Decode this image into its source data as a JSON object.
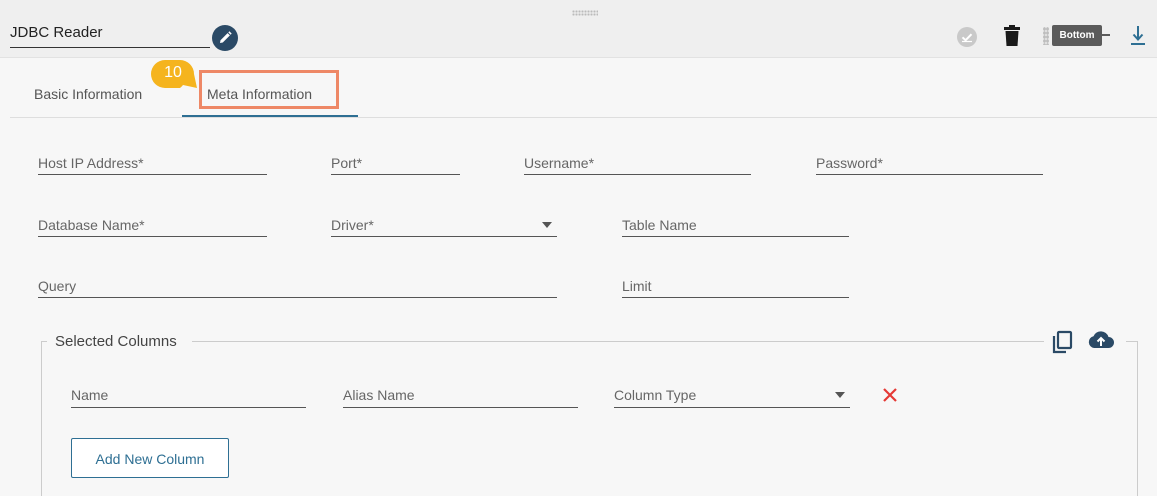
{
  "header": {
    "title": "JDBC Reader",
    "tooltip": "Bottom",
    "icons": [
      "drag-handle-icon",
      "pencil-icon",
      "check-circle-icon",
      "trash-icon",
      "more-vertical-icon",
      "download-icon"
    ]
  },
  "tabs": [
    {
      "label": "Basic Information",
      "active": false
    },
    {
      "label": "Meta Information",
      "active": true
    }
  ],
  "step_badge": "10",
  "form": {
    "host": "Host IP Address*",
    "port": "Port*",
    "username": "Username*",
    "password": "Password*",
    "database": "Database Name*",
    "driver": "Driver*",
    "table": "Table Name",
    "query": "Query",
    "limit": "Limit"
  },
  "selected_columns": {
    "title": "Selected Columns",
    "name": "Name",
    "alias": "Alias Name",
    "column_type": "Column Type",
    "add_button": "Add New Column"
  },
  "colors": {
    "accent": "#2e6f93",
    "edit_button": "#2b4a66",
    "highlight": "#ee8866",
    "badge": "#f5b41e",
    "remove": "#e53935"
  }
}
